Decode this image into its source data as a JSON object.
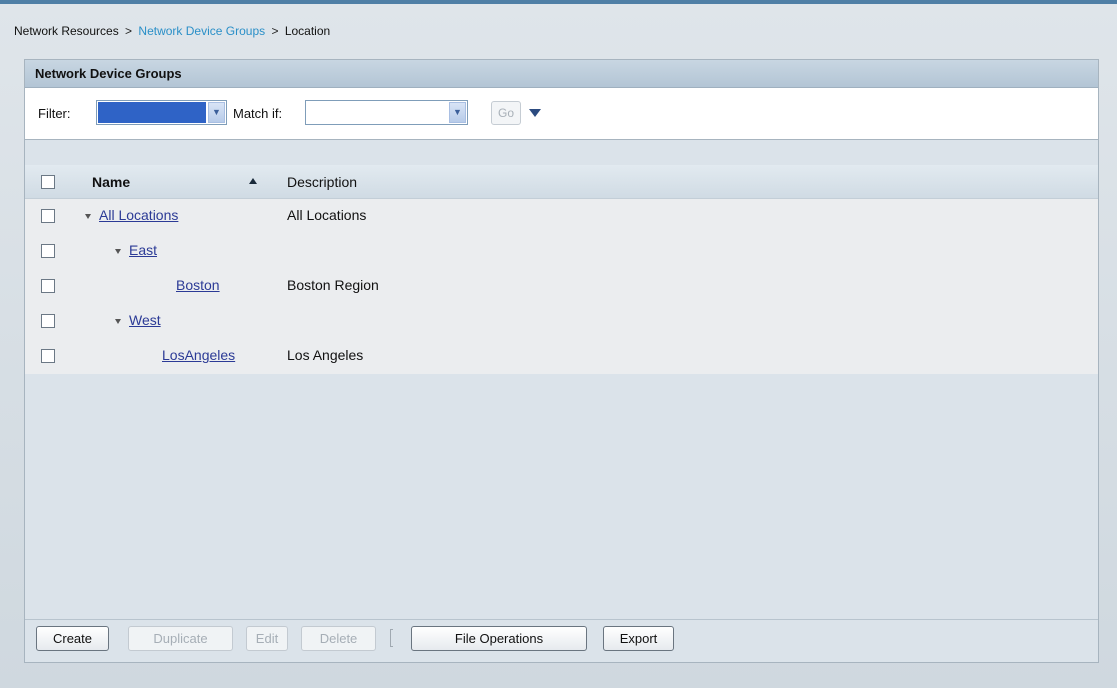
{
  "breadcrumb": {
    "items": [
      {
        "label": "Network Resources"
      },
      {
        "label": "Network Device Groups"
      },
      {
        "label": "Location"
      }
    ],
    "separator": ">"
  },
  "panel": {
    "title": "Network Device Groups"
  },
  "filter": {
    "filter_label": "Filter:",
    "filter_value": "",
    "match_label": "Match if:",
    "match_value": "",
    "go_label": "Go"
  },
  "table": {
    "columns": {
      "name": "Name",
      "description": "Description"
    },
    "sort": "ascending",
    "rows": [
      {
        "name": "All Locations",
        "description": "All Locations",
        "level": 0,
        "expanded": true
      },
      {
        "name": "East",
        "description": "",
        "level": 1,
        "expanded": true
      },
      {
        "name": "Boston",
        "description": "Boston Region",
        "level": 2,
        "expanded": false
      },
      {
        "name": "West",
        "description": "",
        "level": 1,
        "expanded": true
      },
      {
        "name": "LosAngeles",
        "description": "Los Angeles",
        "level": 2,
        "expanded": false
      }
    ]
  },
  "actions": {
    "create": "Create",
    "duplicate": "Duplicate",
    "edit": "Edit",
    "delete": "Delete",
    "file_operations": "File Operations",
    "export": "Export"
  },
  "colors": {
    "accent_bar": "#4f7fa6",
    "link": "#2b3a96",
    "breadcrumb_link": "#2a8fc8",
    "filter_selected": "#2f63c6"
  }
}
